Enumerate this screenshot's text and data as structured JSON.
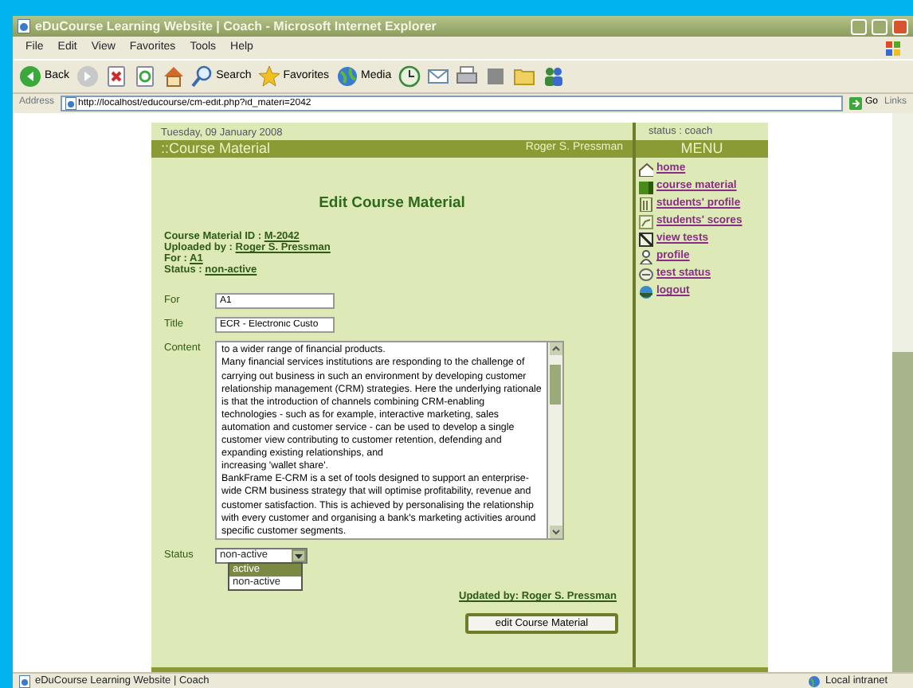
{
  "window": {
    "title": "eDuCourse Learning Website | Coach - Microsoft Internet Explorer"
  },
  "menu_bar": [
    "File",
    "Edit",
    "View",
    "Favorites",
    "Tools",
    "Help"
  ],
  "toolbar": [
    {
      "kind": "back",
      "label": "Back"
    },
    {
      "kind": "forward"
    },
    {
      "kind": "stop"
    },
    {
      "kind": "refresh"
    },
    {
      "kind": "home"
    },
    {
      "kind": "search",
      "label": "Search"
    },
    {
      "kind": "favorites",
      "label": "Favorites"
    },
    {
      "kind": "media",
      "label": "Media"
    },
    {
      "kind": "history"
    },
    {
      "kind": "mail"
    },
    {
      "kind": "print"
    },
    {
      "kind": "edit"
    },
    {
      "kind": "folder"
    },
    {
      "kind": "messenger"
    }
  ],
  "address_bar": {
    "label": "Address",
    "url": "http://localhost/educourse/cm-edit.php?id_materi=2042",
    "go": "Go",
    "links": "Links"
  },
  "page": {
    "date": "Tuesday, 09 January 2008",
    "section": "::Course Material",
    "user": "Roger S. Pressman",
    "heading": "Edit Course Material",
    "info": [
      {
        "label": "Course Material ID :",
        "value": "M-2042"
      },
      {
        "label": "Uploaded by :",
        "value": "Roger S. Pressman"
      },
      {
        "label": "For :",
        "value": "A1"
      },
      {
        "label": "Status :",
        "value": "non-active"
      }
    ],
    "form": {
      "for": {
        "label": "For",
        "value": "A1"
      },
      "title": {
        "label": "Title",
        "value": "ECR - Electronic Custo"
      },
      "content": {
        "label": "Content",
        "value": "to a wider range of financial products.\nMany financial services institutions are responding to the challenge of carrying out business in such an environment by developing customer relationship management (CRM) strategies. Here the underlying rationale is that the introduction of channels combining CRM-enabling technologies - such as for example, interactive marketing, sales automation and customer service - can be used to develop a single customer view contributing to customer retention, defending and expanding existing relationships, and\nincreasing 'wallet share'.\nBankFrame E-CRM is a set of tools designed to support an enterprise-wide CRM business strategy that will optimise profitability, revenue and customer satisfaction. This is achieved by personalising the relationship with every customer and organising a bank's marketing activities around specific customer segments."
      },
      "status": {
        "label": "Status",
        "value": "non-active",
        "expanded": true,
        "options": [
          {
            "label": "active",
            "highlighted": true
          },
          {
            "label": "non-active",
            "highlighted": false
          }
        ]
      }
    },
    "updated_by": "Updated by: Roger S. Pressman",
    "submit": "edit Course Material"
  },
  "sidebar": {
    "status": "status : coach",
    "menu_title": "MENU",
    "items": [
      {
        "kind": "home",
        "label": "home"
      },
      {
        "kind": "material",
        "label": "course material"
      },
      {
        "kind": "students",
        "label": "students' profile"
      },
      {
        "kind": "scores",
        "label": "students' scores"
      },
      {
        "kind": "tests",
        "label": "view tests"
      },
      {
        "kind": "profile",
        "label": "profile"
      },
      {
        "kind": "teststatus",
        "label": "test status"
      },
      {
        "kind": "logout",
        "label": "logout"
      }
    ]
  },
  "status_bar": {
    "text": "eDuCourse Learning Website | Coach",
    "zone": "Local intranet"
  }
}
